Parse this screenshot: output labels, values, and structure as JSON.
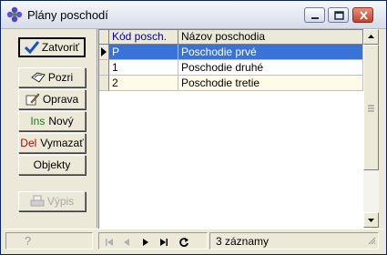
{
  "window": {
    "title": "Plány poschodí",
    "accent": "#3a73d8"
  },
  "toolbar": {
    "buttons": [
      {
        "id": "zatvorit",
        "label": "Zatvoriť",
        "icon": "checkmark-icon"
      },
      {
        "id": "pozri",
        "label": "Pozri",
        "icon": "view-icon"
      },
      {
        "id": "oprava",
        "label": "Oprava",
        "icon": "edit-pencil-icon"
      },
      {
        "id": "novy",
        "prefix": "Ins",
        "label": "Nový"
      },
      {
        "id": "vymazat",
        "prefix": "Del",
        "label": "Vymazať"
      },
      {
        "id": "objekty",
        "label": "Objekty"
      },
      {
        "id": "vypis",
        "label": "Výpis",
        "icon": "printer-icon",
        "disabled": true
      }
    ]
  },
  "grid": {
    "columns": [
      "Kód posch.",
      "Názov poschodia"
    ],
    "rows": [
      {
        "code": "P",
        "name": "Poschodie prvé"
      },
      {
        "code": "1",
        "name": "Poschodie druhé"
      },
      {
        "code": "2",
        "name": "Poschodie tretie"
      }
    ],
    "selected_row": 0
  },
  "statusbar": {
    "help": "?",
    "record_count": "3 záznamy",
    "nav_icons": [
      "first-record-icon",
      "previous-record-icon",
      "next-record-icon",
      "last-record-icon",
      "refresh-icon"
    ]
  }
}
